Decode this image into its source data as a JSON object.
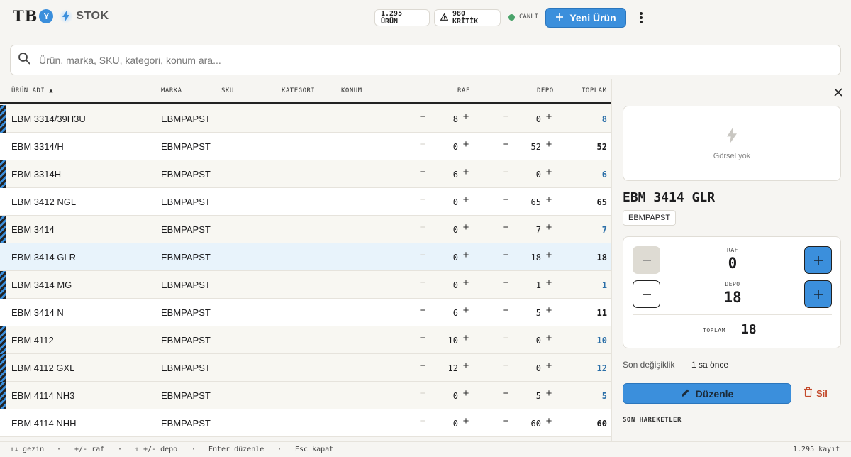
{
  "app": {
    "logo_text": "TB",
    "logo_mark": "Y",
    "product": "STOK"
  },
  "header": {
    "product_count": "1.295 ÜRÜN",
    "critical_count": "980 KRİTİK",
    "live_label": "CANLI",
    "new_button": "Yeni Ürün",
    "accent": "#3b8fdc",
    "live_color": "#4aa36a"
  },
  "search": {
    "placeholder": "Ürün, marka, SKU, kategori, konum ara..."
  },
  "table": {
    "columns": {
      "name": "ÜRÜN ADI",
      "brand": "MARKA",
      "sku": "SKU",
      "category": "KATEGORİ",
      "location": "KONUM",
      "shelf": "RAF",
      "depot": "DEPO",
      "total": "TOPLAM"
    },
    "sort_indicator": "▲",
    "rows": [
      {
        "name": "EBM 3314/39H3U",
        "brand": "EBMPAPST",
        "raf": "8",
        "depo": "0",
        "total": "8"
      },
      {
        "name": "EBM 3314/H",
        "brand": "EBMPAPST",
        "raf": "0",
        "depo": "52",
        "total": "52"
      },
      {
        "name": "EBM 3314H",
        "brand": "EBMPAPST",
        "raf": "6",
        "depo": "0",
        "total": "6"
      },
      {
        "name": "EBM 3412 NGL",
        "brand": "EBMPAPST",
        "raf": "0",
        "depo": "65",
        "total": "65"
      },
      {
        "name": "EBM 3414",
        "brand": "EBMPAPST",
        "raf": "0",
        "depo": "7",
        "total": "7"
      },
      {
        "name": "EBM 3414 GLR",
        "brand": "EBMPAPST",
        "raf": "0",
        "depo": "18",
        "total": "18"
      },
      {
        "name": "EBM 3414 MG",
        "brand": "EBMPAPST",
        "raf": "0",
        "depo": "1",
        "total": "1"
      },
      {
        "name": "EBM 3414 N",
        "brand": "EBMPAPST",
        "raf": "6",
        "depo": "5",
        "total": "11"
      },
      {
        "name": "EBM 4112",
        "brand": "EBMPAPST",
        "raf": "10",
        "depo": "0",
        "total": "10"
      },
      {
        "name": "EBM 4112 GXL",
        "brand": "EBMPAPST",
        "raf": "12",
        "depo": "0",
        "total": "12"
      },
      {
        "name": "EBM 4114 NH3",
        "brand": "EBMPAPST",
        "raf": "0",
        "depo": "5",
        "total": "5"
      },
      {
        "name": "EBM 4114 NHH",
        "brand": "EBMPAPST",
        "raf": "0",
        "depo": "60",
        "total": "60"
      }
    ]
  },
  "panel": {
    "no_image": "Görsel yok",
    "title": "EBM 3414 GLR",
    "brand": "EBMPAPST",
    "raf_label": "RAF",
    "raf_value": "0",
    "depo_label": "DEPO",
    "depo_value": "18",
    "total_label": "TOPLAM",
    "total_value": "18",
    "last_change_label": "Son değişiklik",
    "last_change_value": "1 sa önce",
    "edit_button": "Düzenle",
    "delete_button": "Sil",
    "movements_heading": "SON HAREKETLER",
    "delete_color": "#c44a2c"
  },
  "footer": {
    "nav": "↑↓ gezin",
    "shelf": "+/- raf",
    "depot": "⇧ +/- depo",
    "edit": "Enter düzenle",
    "close": "Esc kapat",
    "sep": "·",
    "records": "1.295 kayıt"
  }
}
